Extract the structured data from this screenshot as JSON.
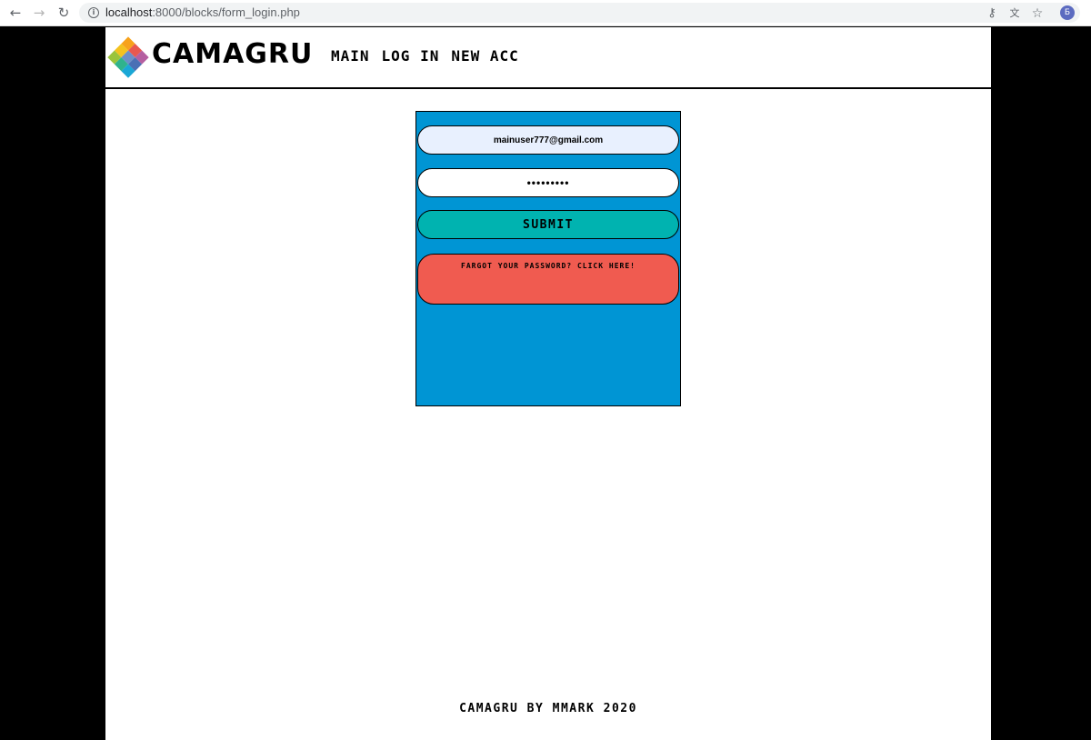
{
  "browser": {
    "url_host": "localhost",
    "url_path": ":8000/blocks/form_login.php",
    "profile_initial": "Б"
  },
  "header": {
    "logo_text": "CAMAGRU",
    "nav": [
      "MAIN",
      "LOG IN",
      "NEW ACC"
    ]
  },
  "form": {
    "email_value": "mainuser777@gmail.com",
    "password_value": "•••••••••",
    "submit_label": "SUBMIT",
    "forgot_label": "FARGOT YOUR PASSWORD? CLICK HERE!"
  },
  "footer": {
    "text": "CAMAGRU BY MMARK 2020"
  },
  "colors": {
    "form_background": "#0095d4",
    "submit": "#00b3b0",
    "forgot": "#f05b50",
    "autofill": "#e8f0fe"
  },
  "icons": [
    "arrow-left-icon",
    "arrow-right-icon",
    "reload-icon",
    "info-icon",
    "key-icon",
    "translate-icon",
    "star-icon"
  ]
}
